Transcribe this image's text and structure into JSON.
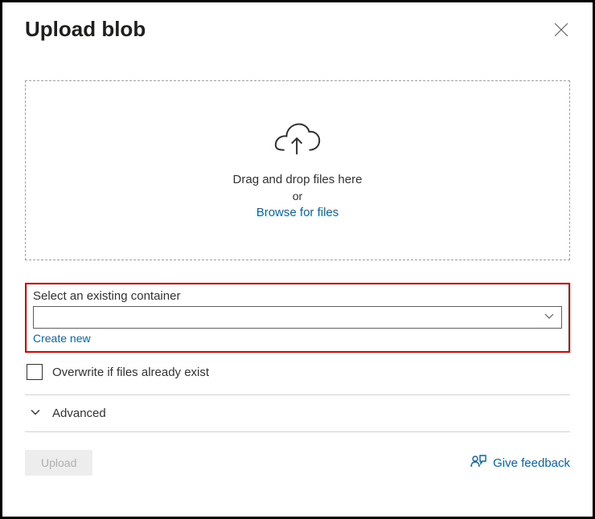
{
  "header": {
    "title": "Upload blob"
  },
  "dropzone": {
    "drag_text": "Drag and drop files here",
    "or_text": "or",
    "browse_text": "Browse for files"
  },
  "container": {
    "label": "Select an existing container",
    "selected_value": "",
    "create_new_label": "Create new"
  },
  "overwrite": {
    "label": "Overwrite if files already exist",
    "checked": false
  },
  "advanced": {
    "label": "Advanced"
  },
  "footer": {
    "upload_label": "Upload",
    "feedback_label": "Give feedback"
  }
}
